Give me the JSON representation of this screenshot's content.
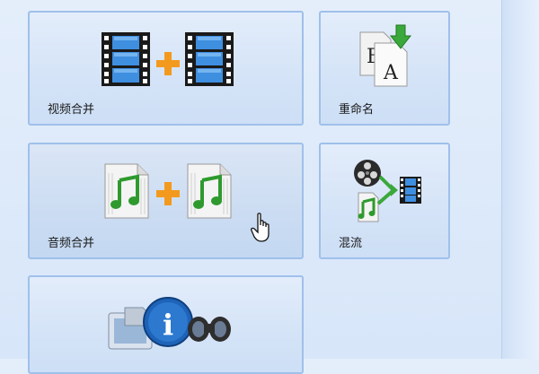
{
  "tiles": [
    {
      "label": "视频合并",
      "icon": "video-merge-icon"
    },
    {
      "label": "重命名",
      "icon": "rename-icon"
    },
    {
      "label": "音频合并",
      "icon": "audio-merge-icon"
    },
    {
      "label": "混流",
      "icon": "mux-icon"
    },
    {
      "label": "",
      "icon": "media-info-icon"
    }
  ],
  "glyphs": {
    "rename_b": "B",
    "rename_a": "A",
    "info_i": "i"
  },
  "colors": {
    "tile_border": "#9fc0ea",
    "plus": "#f39a1e",
    "note_green": "#2e9a2e",
    "info_blue": "#1e63b8"
  }
}
